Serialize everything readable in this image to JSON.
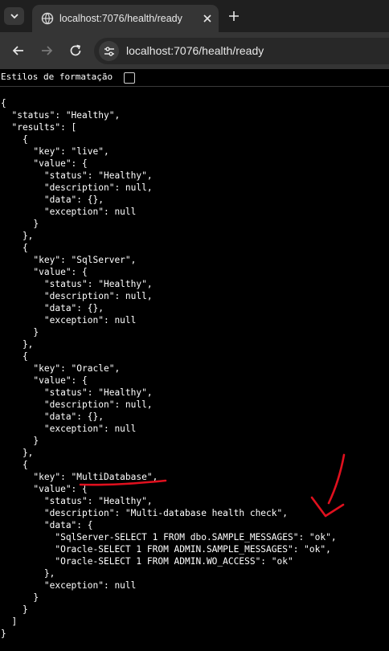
{
  "browser": {
    "tab": {
      "title": "localhost:7076/health/ready"
    },
    "address_bar": {
      "url": "localhost:7076/health/ready"
    }
  },
  "pretty_print": {
    "label": "Estilos de formatação",
    "checked": false
  },
  "json_lines": [
    "{",
    "  \"status\": \"Healthy\",",
    "  \"results\": [",
    "    {",
    "      \"key\": \"live\",",
    "      \"value\": {",
    "        \"status\": \"Healthy\",",
    "        \"description\": null,",
    "        \"data\": {},",
    "        \"exception\": null",
    "      }",
    "    },",
    "    {",
    "      \"key\": \"SqlServer\",",
    "      \"value\": {",
    "        \"status\": \"Healthy\",",
    "        \"description\": null,",
    "        \"data\": {},",
    "        \"exception\": null",
    "      }",
    "    },",
    "    {",
    "      \"key\": \"Oracle\",",
    "      \"value\": {",
    "        \"status\": \"Healthy\",",
    "        \"description\": null,",
    "        \"data\": {},",
    "        \"exception\": null",
    "      }",
    "    },",
    "    {",
    "      \"key\": \"MultiDatabase\",",
    "      \"value\": {",
    "        \"status\": \"Healthy\",",
    "        \"description\": \"Multi-database health check\",",
    "        \"data\": {",
    "          \"SqlServer-SELECT 1 FROM dbo.SAMPLE_MESSAGES\": \"ok\",",
    "          \"Oracle-SELECT 1 FROM ADMIN.SAMPLE_MESSAGES\": \"ok\",",
    "          \"Oracle-SELECT 1 FROM ADMIN.WO_ACCESS\": \"ok\"",
    "        },",
    "        \"exception\": null",
    "      }",
    "    }",
    "  ]",
    "}"
  ],
  "colors": {
    "tab_strip": "#1f1f1f",
    "toolbar": "#353535",
    "page_background": "#000000",
    "annotation_ink": "#e0101e"
  },
  "icons": [
    "tab-search-icon",
    "globe-icon",
    "close-icon",
    "plus-icon",
    "back-arrow-icon",
    "forward-arrow-icon",
    "reload-icon",
    "tune-icon"
  ]
}
